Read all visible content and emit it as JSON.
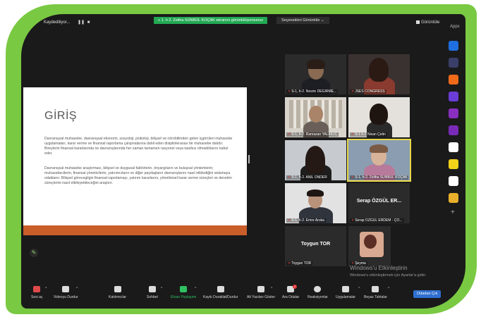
{
  "topbar": {
    "recording_label": "Kaydediliyor...",
    "pause_icon": "pause-icon",
    "stop_icon": "stop-icon",
    "share_banner": "» 1. h 2. Zeliha SÜNBÜL KOÇAK ekranını görüntülüyorsunuz",
    "share_options": "Seçenekleri Görüntüle  ⌄",
    "view_label": "Görüntüle",
    "apps_label": "Apps"
  },
  "slide": {
    "title": "GİRİŞ",
    "paragraph1": "Davranışsal muhasebe, davranışsal ekonomi, sosyoloji, psikoloji, bilişsel ve nörobilimden gelen içgörüleri muhasebe uygulamaları, karar verme ve finansal raporlama çalışmalarına dahil eden disiplinlerarası bir muhasebe dalıdır. Bireylerin finansal kararlarında ne davranışlarında her zaman tamamen rasyonel veya tarafsız olmadıklarını kabul eder.",
    "paragraph2": "Davranışsal muhasebe araştırması, bilişsel ve duygusal faktörlerin, önyargıların ve buluşsal yöntemlerin; muhasebecilerin, finansal yöneticilerin, yatırımcıların ve diğer paydaşların davranışlarını nasıl etkilediğini anlamaya odaklanır. Bilişsel görecegilgin finansal raporlamayı, yatırım kararlarını, yönetimsel karar verme süreçleri ve denetim süreçlerini nasıl etkileyebileceğini araştırır.",
    "footer_color": "#c95e2a"
  },
  "gallery": [
    {
      "name": "S-1, h-2. Nesrin DEĞİRME...",
      "kind": "video"
    },
    {
      "name": "JSES CONGRESS",
      "kind": "video"
    },
    {
      "name": "S-1, h-2. Ramazan YALKILIÇ",
      "kind": "video"
    },
    {
      "name": "S-1 h-2 Nisan Çetin",
      "kind": "video"
    },
    {
      "name": "S-1, h-2. ANIL ÖNDER",
      "kind": "video"
    },
    {
      "name": "S-1, h-2. Zeliha SÜNBÜL KOÇAK",
      "kind": "video",
      "active": true
    },
    {
      "name": "S-1, h-2. Emre Aruka",
      "kind": "video"
    },
    {
      "name": "Serap ÖZGÜL ERDEM - ÇO...",
      "kind": "name",
      "center": "Serap ÖZGÜL ER..."
    },
    {
      "name": "Toygun TOR",
      "kind": "name",
      "center": "Toygun TOR"
    },
    {
      "name": "Şeyma",
      "kind": "video"
    }
  ],
  "watermark": {
    "line1": "Windows'u Etkinleştirin",
    "line2": "Windows'u etkinleştirmek için Ayarlar'a gidin."
  },
  "toolbar": {
    "audio": "Sesi aç",
    "video": "Videoyu Durdur",
    "participants": "Katılımcılar",
    "participants_count": "10",
    "chat": "Sohbet",
    "share": "Ekran Paylaşımı",
    "record": "Kaydı Duraklat/Durdur",
    "captions": "Alt Yazıları Göster",
    "breakout": "Ara Odalar",
    "breakout_badge": "2",
    "reactions": "Reaksiyonlar",
    "apps": "Uygulamalar",
    "whiteboard": "Beyaz Tahtalar",
    "leave": "Odadan Çık"
  },
  "colors": {
    "frame": "#7ac943",
    "screen": "#1a1a1a",
    "accent_green": "#23a854",
    "leave_blue": "#2f6fd0"
  },
  "app_icons": [
    "d-app-icon",
    "miro-icon",
    "slides-icon",
    "wordwall-icon",
    "quiz-icon",
    "prezi-icon",
    "kahoot-icon",
    "smiley-app-icon",
    "twine-icon",
    "grid-app-icon"
  ]
}
